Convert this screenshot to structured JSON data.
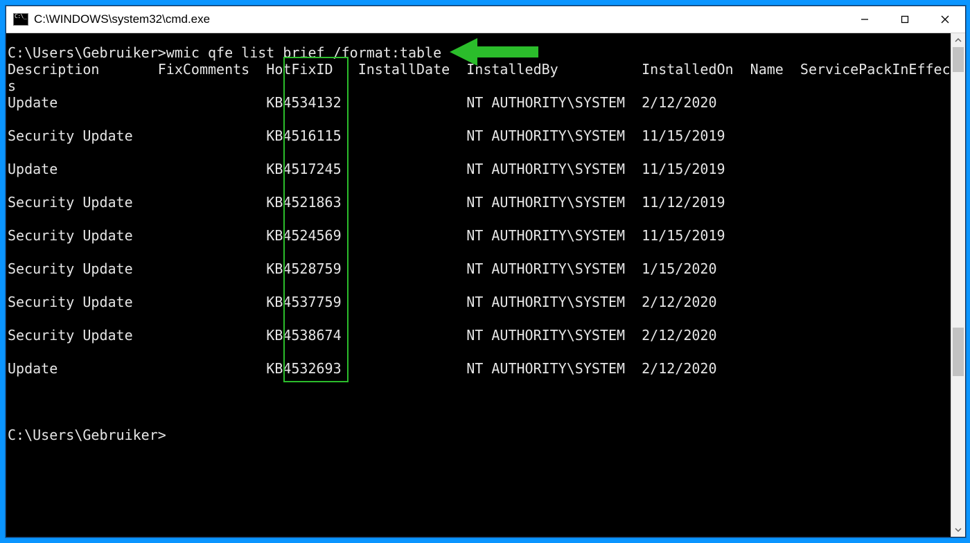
{
  "window": {
    "title": "C:\\WINDOWS\\system32\\cmd.exe"
  },
  "prompt1": "C:\\Users\\Gebruiker>",
  "command": "wmic qfe list brief /format:table",
  "headers": {
    "Description": "Description",
    "FixComments": "FixComments",
    "HotFixID": "HotFixID",
    "InstallDate": "InstallDate",
    "InstalledBy": "InstalledBy",
    "InstalledOn": "InstalledOn",
    "Name": "Name",
    "ServicePackInEffect": "ServicePackInEffect",
    "Status": "Status"
  },
  "header_wrap": "s",
  "rows": [
    {
      "Description": "Update",
      "HotFixID": "KB4534132",
      "InstalledBy": "NT AUTHORITY\\SYSTEM",
      "InstalledOn": "2/12/2020"
    },
    {
      "Description": "Security Update",
      "HotFixID": "KB4516115",
      "InstalledBy": "NT AUTHORITY\\SYSTEM",
      "InstalledOn": "11/15/2019"
    },
    {
      "Description": "Update",
      "HotFixID": "KB4517245",
      "InstalledBy": "NT AUTHORITY\\SYSTEM",
      "InstalledOn": "11/15/2019"
    },
    {
      "Description": "Security Update",
      "HotFixID": "KB4521863",
      "InstalledBy": "NT AUTHORITY\\SYSTEM",
      "InstalledOn": "11/12/2019"
    },
    {
      "Description": "Security Update",
      "HotFixID": "KB4524569",
      "InstalledBy": "NT AUTHORITY\\SYSTEM",
      "InstalledOn": "11/15/2019"
    },
    {
      "Description": "Security Update",
      "HotFixID": "KB4528759",
      "InstalledBy": "NT AUTHORITY\\SYSTEM",
      "InstalledOn": "1/15/2020"
    },
    {
      "Description": "Security Update",
      "HotFixID": "KB4537759",
      "InstalledBy": "NT AUTHORITY\\SYSTEM",
      "InstalledOn": "2/12/2020"
    },
    {
      "Description": "Security Update",
      "HotFixID": "KB4538674",
      "InstalledBy": "NT AUTHORITY\\SYSTEM",
      "InstalledOn": "2/12/2020"
    },
    {
      "Description": "Update",
      "HotFixID": "KB4532693",
      "InstalledBy": "NT AUTHORITY\\SYSTEM",
      "InstalledOn": "2/12/2020"
    }
  ],
  "prompt2": "C:\\Users\\Gebruiker>",
  "columns": {
    "Description": 0,
    "FixComments": 18,
    "HotFixID": 31,
    "InstallDate": 42,
    "InstalledBy": 55,
    "InstalledOn": 76,
    "Name": 89,
    "ServicePackInEffect": 95,
    "Status": 116
  },
  "annotations": {
    "hotfix_box_color": "#2bbd2b",
    "arrow_color": "#2bbd2b"
  }
}
